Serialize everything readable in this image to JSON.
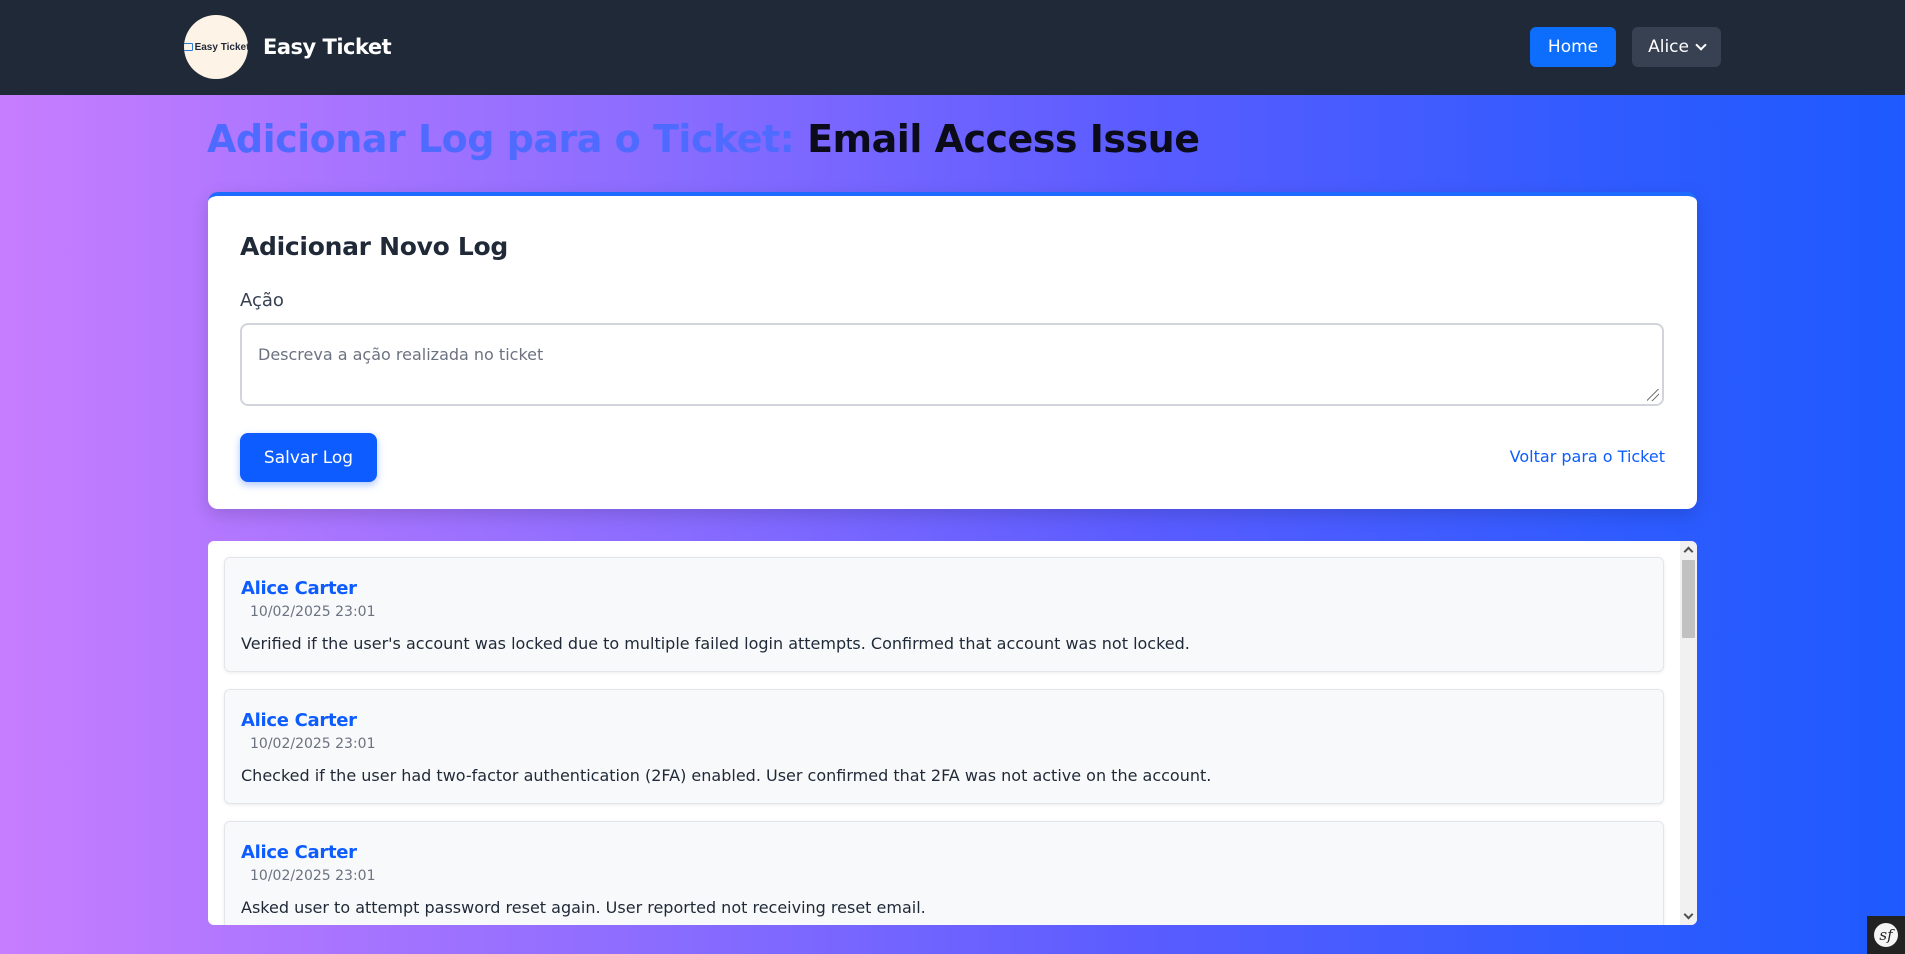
{
  "navbar": {
    "logo_text": "Easy Ticket",
    "brand_name": "Easy Ticket",
    "home_label": "Home",
    "user_label": "Alice"
  },
  "page": {
    "title_prefix": "Adicionar Log para o Ticket:",
    "ticket_name": "Email Access Issue"
  },
  "form": {
    "title": "Adicionar Novo Log",
    "action_label": "Ação",
    "action_placeholder": "Descreva a ação realizada no ticket",
    "action_value": "",
    "save_label": "Salvar Log",
    "back_label": "Voltar para o Ticket"
  },
  "logs": [
    {
      "author": "Alice Carter",
      "date": "10/02/2025 23:01",
      "text": "Verified if the user's account was locked due to multiple failed login attempts. Confirmed that account was not locked."
    },
    {
      "author": "Alice Carter",
      "date": "10/02/2025 23:01",
      "text": "Checked if the user had two-factor authentication (2FA) enabled. User confirmed that 2FA was not active on the account."
    },
    {
      "author": "Alice Carter",
      "date": "10/02/2025 23:01",
      "text": "Asked user to attempt password reset again. User reported not receiving reset email."
    }
  ],
  "colors": {
    "accent": "#0d5cff",
    "navbar_bg": "#1f2937",
    "title_prefix": "#4f6bff"
  }
}
